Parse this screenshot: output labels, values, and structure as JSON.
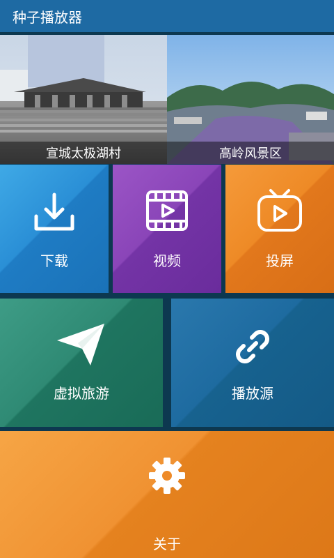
{
  "header": {
    "title": "种子播放器"
  },
  "banners": [
    {
      "caption": "宣城太极湖村"
    },
    {
      "caption": "高岭风景区"
    }
  ],
  "tiles": {
    "download": {
      "label": "下载",
      "icon": "download-icon"
    },
    "video": {
      "label": "视频",
      "icon": "film-play-icon"
    },
    "cast": {
      "label": "投屏",
      "icon": "tv-play-icon"
    },
    "vr_tour": {
      "label": "虚拟旅游",
      "icon": "paper-plane-icon"
    },
    "source": {
      "label": "播放源",
      "icon": "link-icon"
    },
    "about": {
      "label": "关于",
      "icon": "gear-icon"
    }
  },
  "colors": {
    "header": "#1e6aa3",
    "download": "#2a8fd6",
    "video": "#8a45b8",
    "cast": "#ee8a26",
    "vr_tour": "#2f8a74",
    "source": "#1e6ba0",
    "about": "#f09232"
  }
}
